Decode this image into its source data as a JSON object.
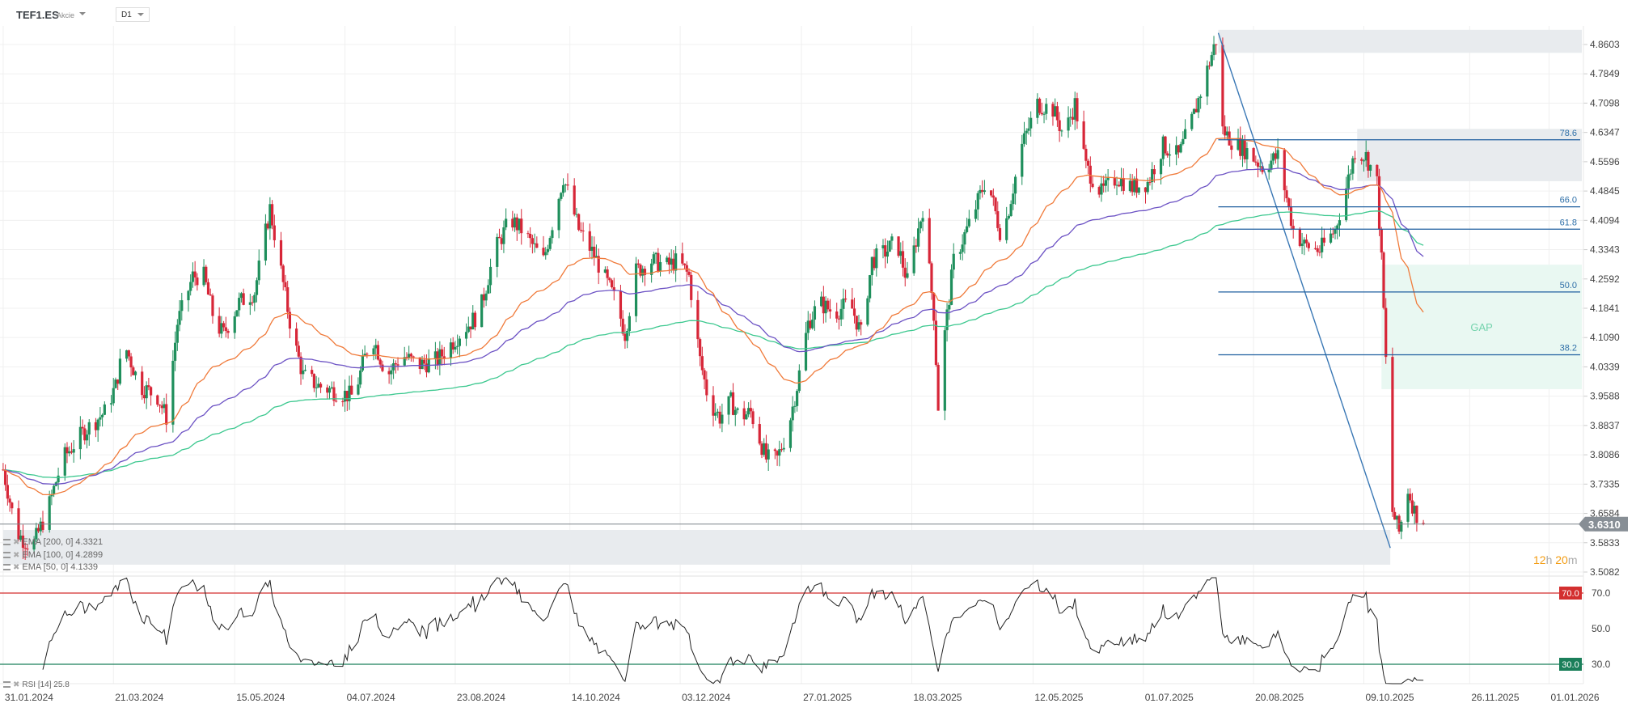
{
  "header": {
    "symbol": "TEF1.ES",
    "type": "Akcie",
    "timeframe": "D1"
  },
  "countdown": {
    "hours": "12",
    "h": "h",
    "minutes": "20",
    "m": "m"
  },
  "legend": [
    {
      "label": "EMA [200, 0] 4.3321"
    },
    {
      "label": "EMA [100, 0] 4.2899"
    },
    {
      "label": "EMA [50, 0] 4.1339"
    }
  ],
  "rsi_legend": "RSI [14] 25.8",
  "colors": {
    "up": "#1f8f5c",
    "down": "#d72638",
    "ema50": "#f07a3a",
    "ema100": "#6c52c4",
    "ema200": "#3cc88f",
    "fib": "#1f5f9f",
    "rsi70": "#d32f2f",
    "rsi30": "#1b7f5a",
    "price_tag": "#878e95",
    "countdown": "#f39c12"
  },
  "chart_data": {
    "type": "candlestick",
    "title": "TEF1.ES D1",
    "price_ticks": [
      "4.8603",
      "4.7849",
      "4.7098",
      "4.6347",
      "4.5596",
      "4.4845",
      "4.4094",
      "4.3343",
      "4.2592",
      "4.1841",
      "4.1090",
      "4.0339",
      "3.9588",
      "3.8837",
      "3.8086",
      "3.7335",
      "3.6584",
      "3.5833",
      "3.5082"
    ],
    "ylim": [
      3.5082,
      4.8603
    ],
    "x_labels": [
      "31.01.2024",
      "21.03.2024",
      "15.05.2024",
      "04.07.2024",
      "23.08.2024",
      "14.10.2024",
      "03.12.2024",
      "27.01.2025",
      "18.03.2025",
      "12.05.2025",
      "01.07.2025",
      "20.08.2025",
      "09.10.2025",
      "26.11.2025",
      "01.01.2026"
    ],
    "x_label_days": [
      0,
      50,
      105,
      155,
      205,
      257,
      307,
      362,
      412,
      467,
      517,
      567,
      617,
      665,
      701
    ],
    "close_anchors_day_price": [
      [
        0,
        3.771
      ],
      [
        6,
        3.61
      ],
      [
        13,
        3.57
      ],
      [
        20,
        3.664
      ],
      [
        27,
        3.798
      ],
      [
        36,
        3.864
      ],
      [
        46,
        3.918
      ],
      [
        51,
        3.985
      ],
      [
        55,
        4.092
      ],
      [
        62,
        3.985
      ],
      [
        70,
        3.958
      ],
      [
        74,
        3.905
      ],
      [
        79,
        4.146
      ],
      [
        86,
        4.266
      ],
      [
        91,
        4.266
      ],
      [
        96,
        4.146
      ],
      [
        100,
        4.119
      ],
      [
        107,
        4.199
      ],
      [
        114,
        4.226
      ],
      [
        121,
        4.44
      ],
      [
        126,
        4.279
      ],
      [
        131,
        4.119
      ],
      [
        136,
        4.012
      ],
      [
        143,
        3.985
      ],
      [
        150,
        3.972
      ],
      [
        159,
        3.958
      ],
      [
        167,
        4.119
      ],
      [
        174,
        4.012
      ],
      [
        181,
        4.065
      ],
      [
        188,
        4.038
      ],
      [
        197,
        4.052
      ],
      [
        207,
        4.119
      ],
      [
        216,
        4.172
      ],
      [
        223,
        4.333
      ],
      [
        230,
        4.413
      ],
      [
        235,
        4.386
      ],
      [
        245,
        4.306
      ],
      [
        254,
        4.52
      ],
      [
        261,
        4.386
      ],
      [
        268,
        4.32
      ],
      [
        278,
        4.199
      ],
      [
        282,
        4.119
      ],
      [
        287,
        4.279
      ],
      [
        294,
        4.306
      ],
      [
        301,
        4.293
      ],
      [
        306,
        4.306
      ],
      [
        311,
        4.266
      ],
      [
        316,
        4.052
      ],
      [
        320,
        3.945
      ],
      [
        325,
        3.905
      ],
      [
        330,
        3.945
      ],
      [
        334,
        3.905
      ],
      [
        339,
        3.918
      ],
      [
        346,
        3.798
      ],
      [
        351,
        3.798
      ],
      [
        356,
        3.878
      ],
      [
        360,
        3.985
      ],
      [
        365,
        4.146
      ],
      [
        370,
        4.199
      ],
      [
        377,
        4.172
      ],
      [
        384,
        4.199
      ],
      [
        389,
        4.119
      ],
      [
        394,
        4.306
      ],
      [
        401,
        4.333
      ],
      [
        405,
        4.36
      ],
      [
        410,
        4.253
      ],
      [
        417,
        4.44
      ],
      [
        422,
        4.172
      ],
      [
        424,
        3.932
      ],
      [
        427,
        4.119
      ],
      [
        431,
        4.306
      ],
      [
        439,
        4.413
      ],
      [
        446,
        4.52
      ],
      [
        453,
        4.36
      ],
      [
        457,
        4.467
      ],
      [
        462,
        4.601
      ],
      [
        469,
        4.708
      ],
      [
        476,
        4.694
      ],
      [
        481,
        4.627
      ],
      [
        486,
        4.708
      ],
      [
        491,
        4.547
      ],
      [
        498,
        4.48
      ],
      [
        505,
        4.52
      ],
      [
        512,
        4.494
      ],
      [
        519,
        4.507
      ],
      [
        526,
        4.601
      ],
      [
        533,
        4.574
      ],
      [
        540,
        4.681
      ],
      [
        547,
        4.815
      ],
      [
        551,
        4.89
      ],
      [
        553,
        4.641
      ],
      [
        557,
        4.614
      ],
      [
        564,
        4.587
      ],
      [
        571,
        4.547
      ],
      [
        578,
        4.574
      ],
      [
        585,
        4.386
      ],
      [
        590,
        4.346
      ],
      [
        597,
        4.333
      ],
      [
        604,
        4.386
      ],
      [
        609,
        4.494
      ],
      [
        613,
        4.587
      ],
      [
        618,
        4.574
      ],
      [
        623,
        4.507
      ],
      [
        625,
        4.306
      ],
      [
        627,
        4.05
      ],
      [
        629,
        3.68
      ],
      [
        633,
        3.61
      ],
      [
        637,
        3.72
      ],
      [
        640,
        3.664
      ],
      [
        644,
        3.631
      ]
    ],
    "last_price": "3.6310",
    "ema_periods": [
      50,
      100,
      200
    ],
    "fibonacci": {
      "high": 4.908,
      "low": 3.544,
      "start_day": 551,
      "end_day": 640,
      "levels": [
        "78.6",
        "66.0",
        "61.8",
        "50.0",
        "38.2"
      ]
    },
    "zones": [
      {
        "name": "top-zone",
        "from_day": 551,
        "to": "end",
        "price_low": 4.839,
        "price_high": 4.898
      },
      {
        "name": "resistance-zone",
        "from_day": 614,
        "to": "end",
        "price_low": 4.51,
        "price_high": 4.644
      },
      {
        "name": "gap-zone",
        "from_day": 625,
        "to": "end",
        "price_low": 3.977,
        "price_high": 4.296,
        "label": "GAP"
      },
      {
        "name": "bottom-zone",
        "from_day": 0,
        "to_day": 629,
        "price_low": 3.527,
        "price_high": 3.616
      }
    ],
    "rsi": {
      "period": 14,
      "upper": "70.0",
      "lower": "30.0",
      "ticks": [
        "70.0",
        "50.0",
        "30.0"
      ],
      "value": 25.8
    }
  }
}
